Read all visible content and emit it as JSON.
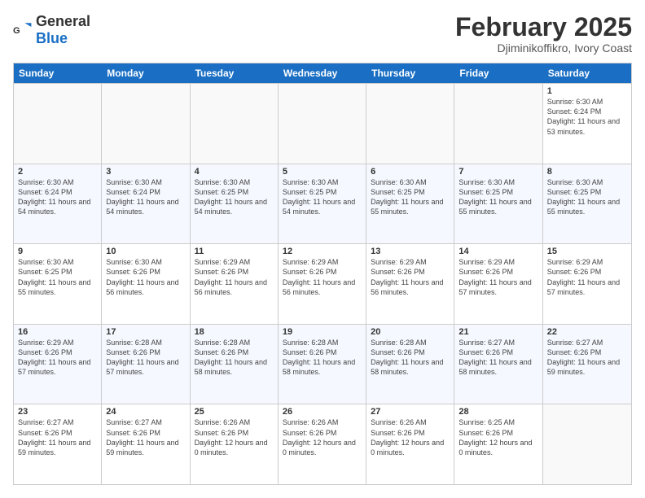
{
  "header": {
    "logo_general": "General",
    "logo_blue": "Blue",
    "month_title": "February 2025",
    "location": "Djiminikoffikro, Ivory Coast"
  },
  "days_of_week": [
    "Sunday",
    "Monday",
    "Tuesday",
    "Wednesday",
    "Thursday",
    "Friday",
    "Saturday"
  ],
  "weeks": [
    [
      {
        "day": "",
        "info": ""
      },
      {
        "day": "",
        "info": ""
      },
      {
        "day": "",
        "info": ""
      },
      {
        "day": "",
        "info": ""
      },
      {
        "day": "",
        "info": ""
      },
      {
        "day": "",
        "info": ""
      },
      {
        "day": "1",
        "info": "Sunrise: 6:30 AM\nSunset: 6:24 PM\nDaylight: 11 hours and 53 minutes."
      }
    ],
    [
      {
        "day": "2",
        "info": "Sunrise: 6:30 AM\nSunset: 6:24 PM\nDaylight: 11 hours and 54 minutes."
      },
      {
        "day": "3",
        "info": "Sunrise: 6:30 AM\nSunset: 6:24 PM\nDaylight: 11 hours and 54 minutes."
      },
      {
        "day": "4",
        "info": "Sunrise: 6:30 AM\nSunset: 6:25 PM\nDaylight: 11 hours and 54 minutes."
      },
      {
        "day": "5",
        "info": "Sunrise: 6:30 AM\nSunset: 6:25 PM\nDaylight: 11 hours and 54 minutes."
      },
      {
        "day": "6",
        "info": "Sunrise: 6:30 AM\nSunset: 6:25 PM\nDaylight: 11 hours and 55 minutes."
      },
      {
        "day": "7",
        "info": "Sunrise: 6:30 AM\nSunset: 6:25 PM\nDaylight: 11 hours and 55 minutes."
      },
      {
        "day": "8",
        "info": "Sunrise: 6:30 AM\nSunset: 6:25 PM\nDaylight: 11 hours and 55 minutes."
      }
    ],
    [
      {
        "day": "9",
        "info": "Sunrise: 6:30 AM\nSunset: 6:25 PM\nDaylight: 11 hours and 55 minutes."
      },
      {
        "day": "10",
        "info": "Sunrise: 6:30 AM\nSunset: 6:26 PM\nDaylight: 11 hours and 56 minutes."
      },
      {
        "day": "11",
        "info": "Sunrise: 6:29 AM\nSunset: 6:26 PM\nDaylight: 11 hours and 56 minutes."
      },
      {
        "day": "12",
        "info": "Sunrise: 6:29 AM\nSunset: 6:26 PM\nDaylight: 11 hours and 56 minutes."
      },
      {
        "day": "13",
        "info": "Sunrise: 6:29 AM\nSunset: 6:26 PM\nDaylight: 11 hours and 56 minutes."
      },
      {
        "day": "14",
        "info": "Sunrise: 6:29 AM\nSunset: 6:26 PM\nDaylight: 11 hours and 57 minutes."
      },
      {
        "day": "15",
        "info": "Sunrise: 6:29 AM\nSunset: 6:26 PM\nDaylight: 11 hours and 57 minutes."
      }
    ],
    [
      {
        "day": "16",
        "info": "Sunrise: 6:29 AM\nSunset: 6:26 PM\nDaylight: 11 hours and 57 minutes."
      },
      {
        "day": "17",
        "info": "Sunrise: 6:28 AM\nSunset: 6:26 PM\nDaylight: 11 hours and 57 minutes."
      },
      {
        "day": "18",
        "info": "Sunrise: 6:28 AM\nSunset: 6:26 PM\nDaylight: 11 hours and 58 minutes."
      },
      {
        "day": "19",
        "info": "Sunrise: 6:28 AM\nSunset: 6:26 PM\nDaylight: 11 hours and 58 minutes."
      },
      {
        "day": "20",
        "info": "Sunrise: 6:28 AM\nSunset: 6:26 PM\nDaylight: 11 hours and 58 minutes."
      },
      {
        "day": "21",
        "info": "Sunrise: 6:27 AM\nSunset: 6:26 PM\nDaylight: 11 hours and 58 minutes."
      },
      {
        "day": "22",
        "info": "Sunrise: 6:27 AM\nSunset: 6:26 PM\nDaylight: 11 hours and 59 minutes."
      }
    ],
    [
      {
        "day": "23",
        "info": "Sunrise: 6:27 AM\nSunset: 6:26 PM\nDaylight: 11 hours and 59 minutes."
      },
      {
        "day": "24",
        "info": "Sunrise: 6:27 AM\nSunset: 6:26 PM\nDaylight: 11 hours and 59 minutes."
      },
      {
        "day": "25",
        "info": "Sunrise: 6:26 AM\nSunset: 6:26 PM\nDaylight: 12 hours and 0 minutes."
      },
      {
        "day": "26",
        "info": "Sunrise: 6:26 AM\nSunset: 6:26 PM\nDaylight: 12 hours and 0 minutes."
      },
      {
        "day": "27",
        "info": "Sunrise: 6:26 AM\nSunset: 6:26 PM\nDaylight: 12 hours and 0 minutes."
      },
      {
        "day": "28",
        "info": "Sunrise: 6:25 AM\nSunset: 6:26 PM\nDaylight: 12 hours and 0 minutes."
      },
      {
        "day": "",
        "info": ""
      }
    ]
  ]
}
